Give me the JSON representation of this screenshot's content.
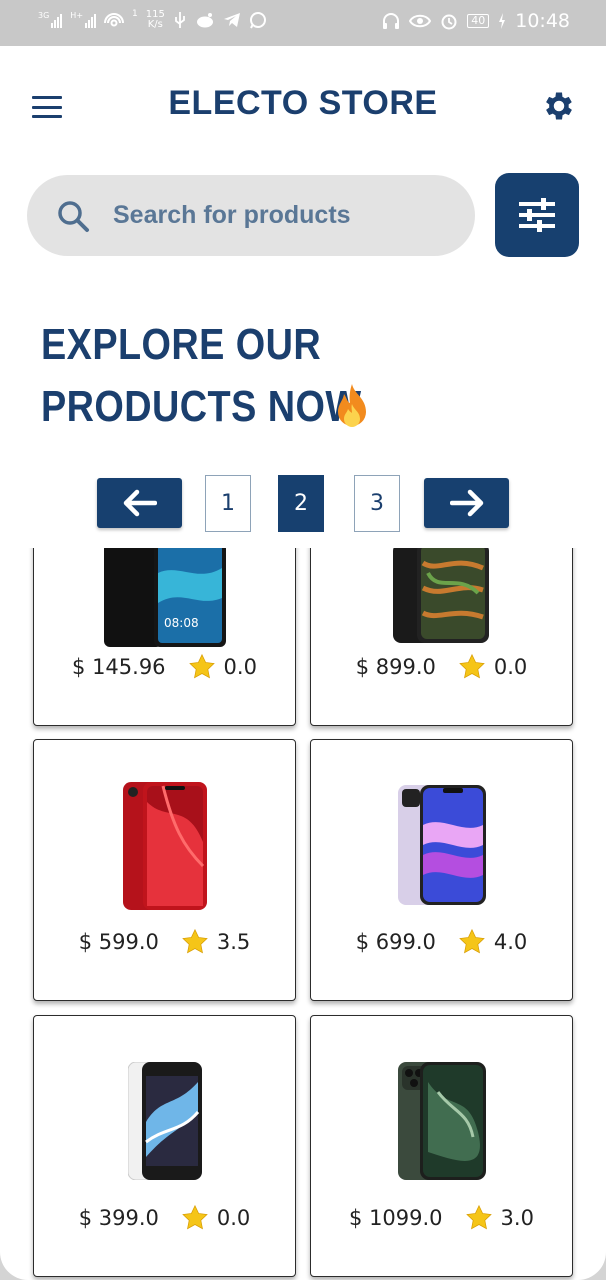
{
  "status_bar": {
    "left": {
      "net1": "3G",
      "net2": "H+",
      "net_speed_top": "115",
      "net_speed_bottom": "K/s",
      "sim_index": "1"
    },
    "right": {
      "battery": "40",
      "time": "10:48"
    }
  },
  "header": {
    "title": "ELECTO STORE",
    "menu_icon": "hamburger-menu-icon",
    "settings_icon": "gear-icon"
  },
  "search": {
    "placeholder": "Search for products",
    "value": "",
    "filter_icon": "sliders-icon"
  },
  "headline": {
    "line1": "EXPLORE OUR",
    "line2": "PRODUCTS NOW",
    "emoji": "fire-icon"
  },
  "pagination": {
    "prev_icon": "arrow-left-icon",
    "next_icon": "arrow-right-icon",
    "pages": [
      "1",
      "2",
      "3"
    ],
    "current": "2"
  },
  "products": [
    {
      "price": "$ 145.96",
      "rating": "0.0",
      "image": "huawei-phone-image"
    },
    {
      "price": "$ 899.0",
      "rating": "0.0",
      "image": "iphone-xs-image"
    },
    {
      "price": "$ 599.0",
      "rating": "3.5",
      "image": "iphone-xr-red-image"
    },
    {
      "price": "$ 699.0",
      "rating": "4.0",
      "image": "iphone-11-purple-image"
    },
    {
      "price": "$ 399.0",
      "rating": "0.0",
      "image": "iphone-se-white-image"
    },
    {
      "price": "$ 1099.0",
      "rating": "3.0",
      "image": "iphone-11-pro-green-image"
    }
  ],
  "colors": {
    "brand": "#1b3f6e",
    "button": "#17406f",
    "search_bg": "#e3e3e3",
    "star": "#f5c518"
  }
}
